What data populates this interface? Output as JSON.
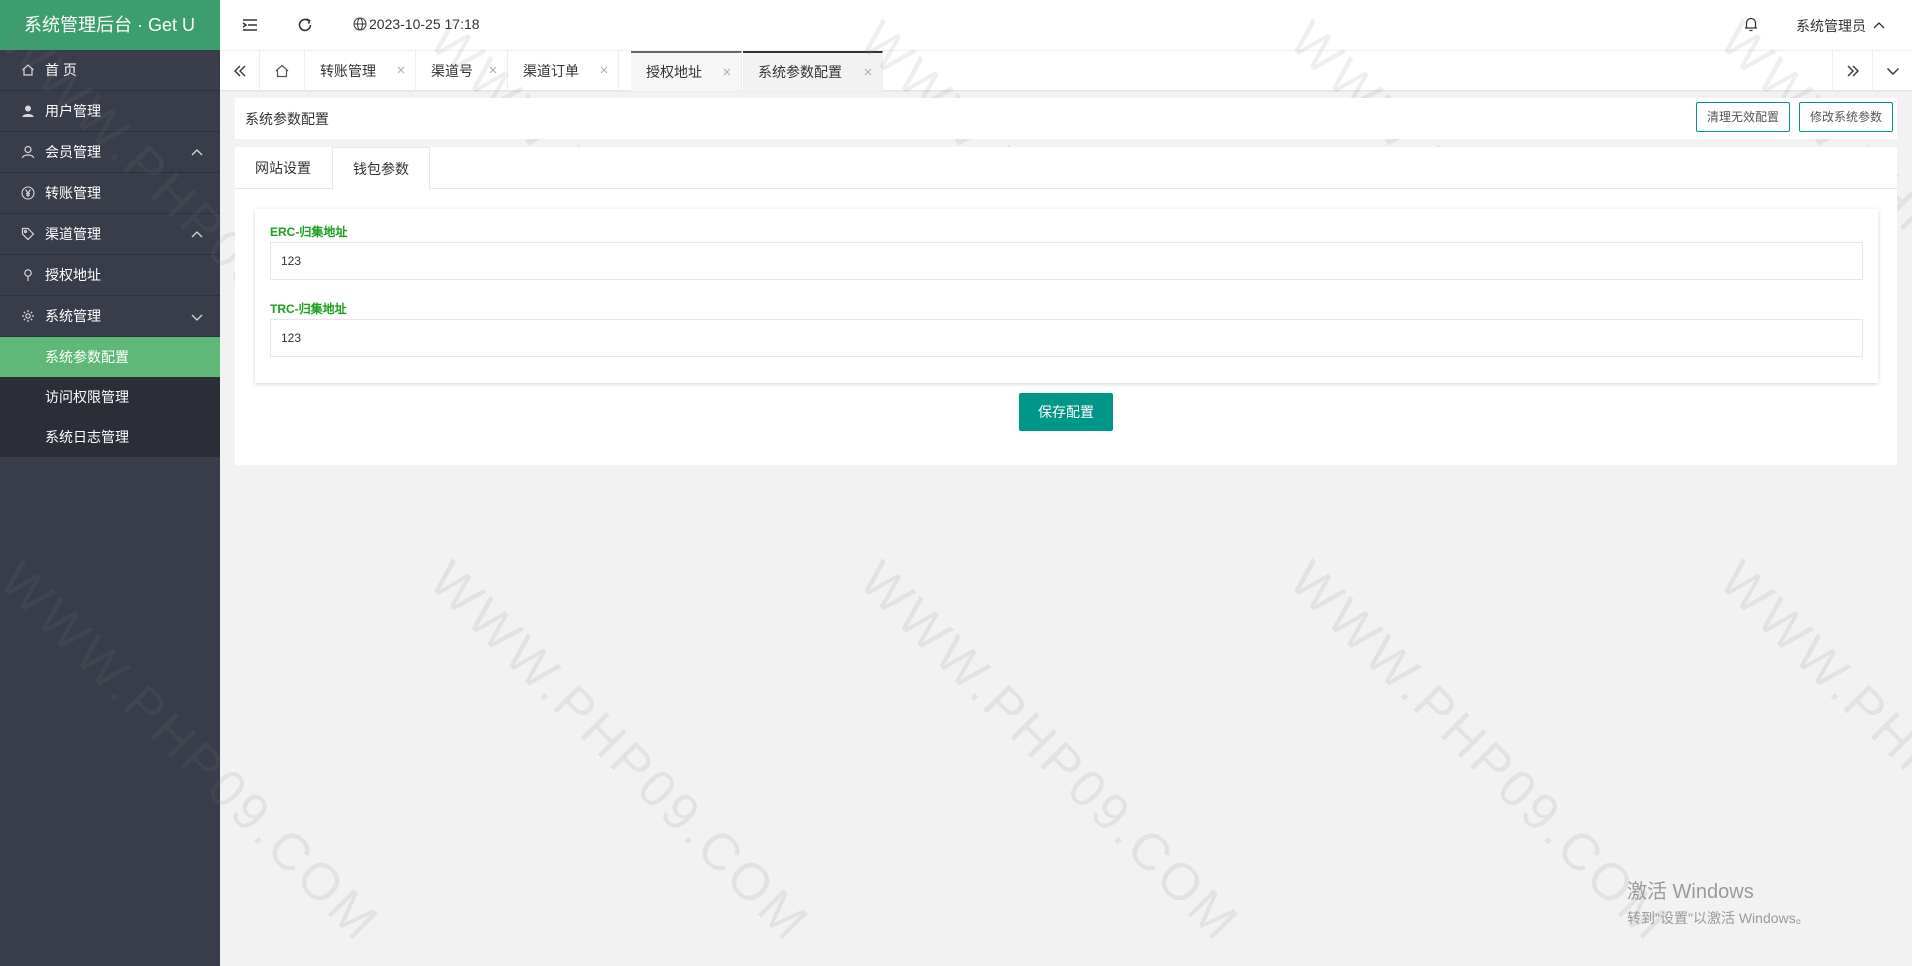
{
  "app": {
    "title": "系统管理后台 · Get U"
  },
  "header": {
    "datetime": "2023-10-25 17:18",
    "user": "系统管理员"
  },
  "sidebar": {
    "items": [
      {
        "label": "首 页",
        "icon": "home-icon"
      },
      {
        "label": "用户管理",
        "icon": "user-icon"
      },
      {
        "label": "会员管理",
        "icon": "member-icon"
      },
      {
        "label": "转账管理",
        "icon": "yen-icon"
      },
      {
        "label": "渠道管理",
        "icon": "tag-icon"
      },
      {
        "label": "授权地址",
        "icon": "location-icon"
      },
      {
        "label": "系统管理",
        "icon": "gear-icon"
      }
    ],
    "subitems": [
      {
        "label": "系统参数配置",
        "active": true
      },
      {
        "label": "访问权限管理"
      },
      {
        "label": "系统日志管理"
      }
    ]
  },
  "tabs": [
    {
      "label": "转账管理"
    },
    {
      "label": "渠道号"
    },
    {
      "label": "渠道订单"
    },
    {
      "label": "授权地址"
    },
    {
      "label": "系统参数配置"
    }
  ],
  "page": {
    "title": "系统参数配置",
    "clear_button": "清理无效配置",
    "edit_button": "修改系统参数"
  },
  "card": {
    "tabs": [
      {
        "label": "网站设置"
      },
      {
        "label": "钱包参数"
      }
    ],
    "active_tab": "钱包参数",
    "fields": [
      {
        "label": "ERC-归集地址",
        "value": "123"
      },
      {
        "label": "TRC-归集地址",
        "value": "123"
      }
    ],
    "save_button": "保存配置"
  },
  "watermark": {
    "text": "WWW.PHP09.COM"
  },
  "windows_activation": {
    "line1": "激活 Windows",
    "line2": "转到\"设置\"以激活 Windows。"
  },
  "colors": {
    "accent": "#009688",
    "sidebar": "#393d49",
    "active_menu": "#5fb878",
    "logo": "#3c9e6d",
    "label_green": "#1aa01a"
  }
}
